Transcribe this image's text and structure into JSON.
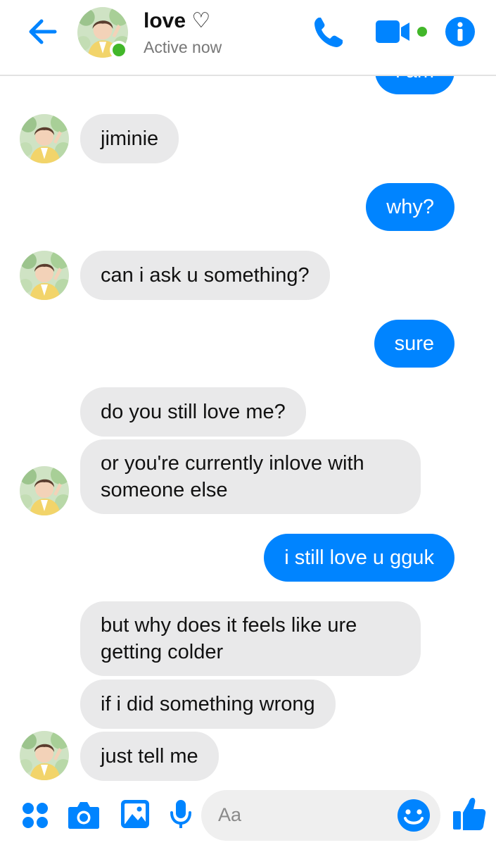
{
  "header": {
    "contact_name": "love ♡",
    "status": "Active now"
  },
  "messages": [
    {
      "side": "out",
      "text": "i am"
    },
    {
      "side": "in",
      "text": "jiminie"
    },
    {
      "side": "out",
      "text": "why?"
    },
    {
      "side": "in",
      "text": "can i ask u something?"
    },
    {
      "side": "out",
      "text": "sure"
    },
    {
      "side": "in",
      "text": "do you still love me?"
    },
    {
      "side": "in",
      "text": "or you're currently inlove with someone else"
    },
    {
      "side": "out",
      "text": "i still love u gguk"
    },
    {
      "side": "in",
      "text": "but why does it feels like ure getting colder"
    },
    {
      "side": "in",
      "text": "if i did something wrong"
    },
    {
      "side": "in",
      "text": "just tell me"
    }
  ],
  "composer": {
    "placeholder": "Aa"
  },
  "colors": {
    "accent": "#0084ff",
    "incoming_bubble": "#e9e9ea",
    "online": "#42b72a"
  },
  "icons": [
    "back-arrow-icon",
    "phone-icon",
    "video-camera-icon",
    "info-icon",
    "apps-grid-icon",
    "camera-icon",
    "gallery-icon",
    "microphone-icon",
    "emoji-icon",
    "thumbs-up-icon"
  ]
}
